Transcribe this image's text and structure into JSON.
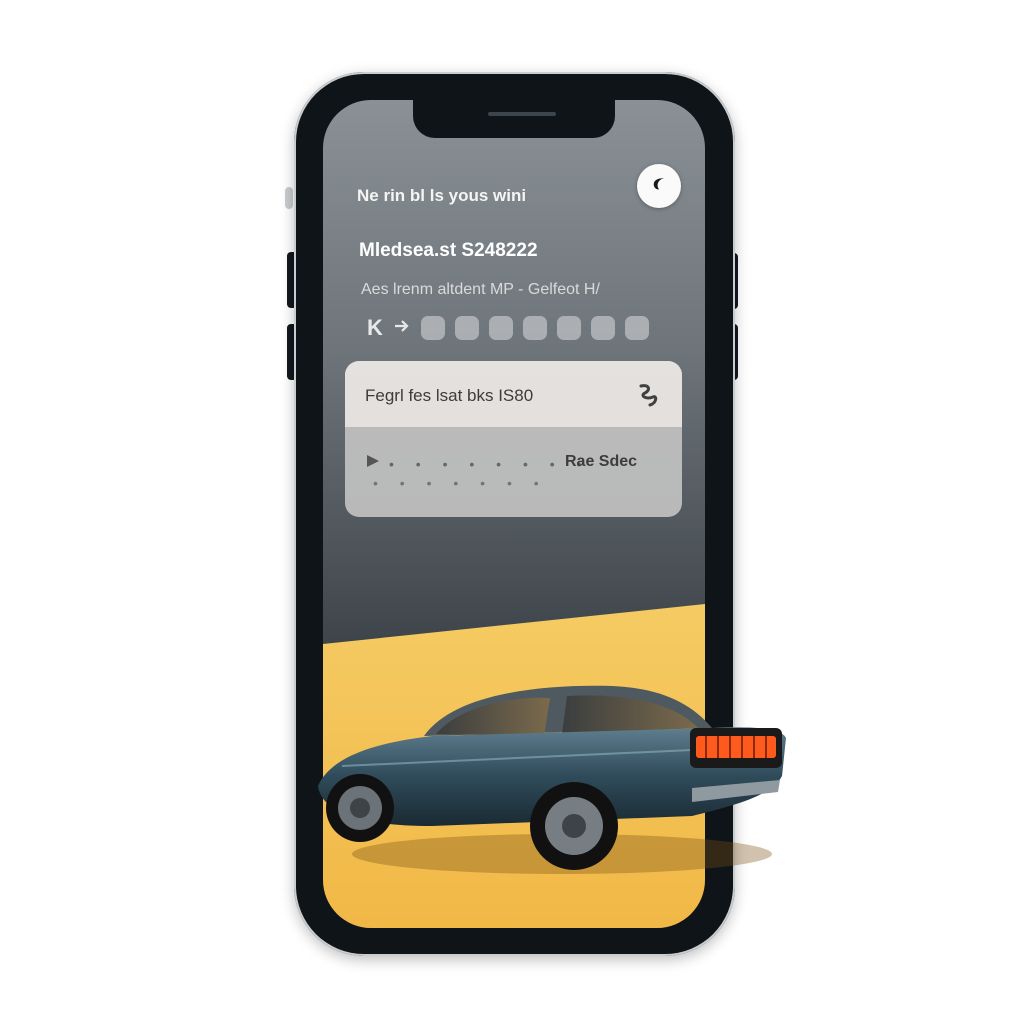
{
  "header": {
    "subtitle": "Ne rin bl ls yous wini",
    "headline": "Mledsea.st  S248222",
    "info": "Aes lrenm altdent  MP  -  Gelfeot  H/"
  },
  "controls": {
    "back_label": "K",
    "forward_label": "‹ ›"
  },
  "card": {
    "title": "Fegrl fes lsat bks IS80",
    "label": "Rae Sdec"
  },
  "colors": {
    "accent": "#f6c44f",
    "screen_top": "#8a9196",
    "screen_bottom": "#23292f",
    "car_body": "#2f4b5a",
    "taillight": "#ff4a12"
  },
  "icons": [
    "moon-icon",
    "back-icon",
    "forward-icon",
    "curve-icon",
    "play-icon"
  ]
}
